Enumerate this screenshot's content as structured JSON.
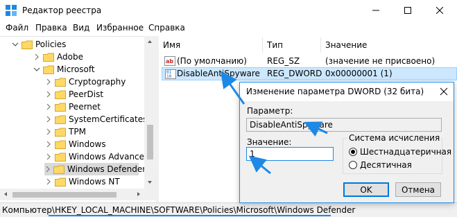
{
  "window": {
    "title": "Редактор реестра",
    "icon": "registry-editor-icon"
  },
  "menu": [
    "Файл",
    "Правка",
    "Вид",
    "Избранное",
    "Справка"
  ],
  "tree": {
    "items": [
      {
        "label": "Policies",
        "expanded": true,
        "selected": false
      },
      {
        "label": "Adobe",
        "expanded": false,
        "selected": false
      },
      {
        "label": "Microsoft",
        "expanded": true,
        "selected": false
      },
      {
        "label": "Cryptography",
        "expanded": false,
        "selected": false
      },
      {
        "label": "PeerDist",
        "expanded": false,
        "selected": false
      },
      {
        "label": "Peernet",
        "expanded": false,
        "selected": false
      },
      {
        "label": "SystemCertificates",
        "expanded": false,
        "selected": false
      },
      {
        "label": "TPM",
        "expanded": false,
        "selected": false
      },
      {
        "label": "Windows",
        "expanded": false,
        "selected": false
      },
      {
        "label": "Windows Advanced Th",
        "expanded": false,
        "selected": false
      },
      {
        "label": "Windows Defender",
        "expanded": false,
        "selected": true
      },
      {
        "label": "Windows NT",
        "expanded": false,
        "selected": false
      }
    ]
  },
  "list": {
    "columns": [
      "Имя",
      "Тип",
      "Значение"
    ],
    "rows": [
      {
        "name": "(По умолчанию)",
        "type": "REG_SZ",
        "value": "(значение не присвоено)",
        "icon": "string-value-icon",
        "selected": false
      },
      {
        "name": "DisableAntiSpyware",
        "type": "REG_DWORD",
        "value": "0x00000001 (1)",
        "icon": "dword-value-icon",
        "selected": true
      }
    ]
  },
  "dialog": {
    "title": "Изменение параметра DWORD (32 бита)",
    "param_label": "Параметр:",
    "param_value": "DisableAntiSpyware",
    "value_label": "Значение:",
    "value": "1",
    "base_group": "Система исчисления",
    "radio_hex": "Шестнадцатеричная",
    "radio_dec": "Десятичная",
    "ok": "OK",
    "cancel": "Отмена"
  },
  "status": {
    "prefix": "Компьютер\\",
    "path": "HKEY_LOCAL_MACHINE\\SOFTWARE\\Policies\\Microsoft\\Windows Defender"
  },
  "colors": {
    "accent": "#1e88e5",
    "selection": "#cce8ff",
    "folder": "#ffd866"
  }
}
